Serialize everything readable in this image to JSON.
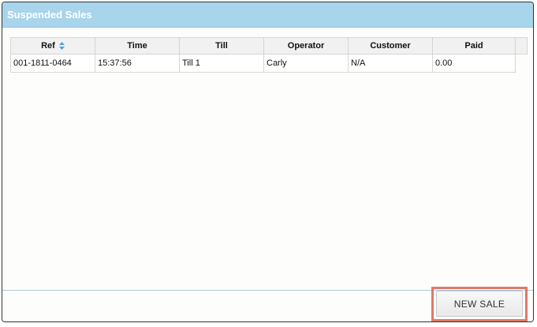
{
  "window": {
    "title": "Suspended Sales"
  },
  "table": {
    "columns": [
      "Ref",
      "Time",
      "Till",
      "Operator",
      "Customer",
      "Paid"
    ],
    "rows": [
      [
        "001-1811-0464",
        "15:37:56",
        "Till 1",
        "Carly",
        "N/A",
        "0.00"
      ]
    ],
    "sort_indicator_icon": "sort-up-down-icon"
  },
  "footer": {
    "new_sale_label": "NEW SALE"
  },
  "colors": {
    "titlebar": "#a8d4ec",
    "sort_icon": "#4a9fd8",
    "highlight_outline": "#e07868"
  }
}
